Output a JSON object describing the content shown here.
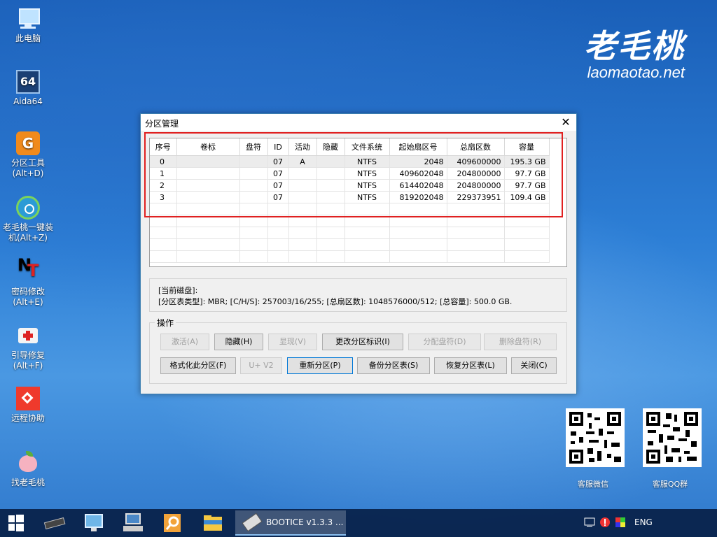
{
  "desktop_icons": [
    {
      "name": "this-pc",
      "label": "此电脑",
      "icon": "computer-icon"
    },
    {
      "name": "aida64",
      "label": "Aida64",
      "icon": "aida64-icon"
    },
    {
      "name": "partition-tool",
      "label": "分区工具\n(Alt+D)",
      "icon": "diskgenius-icon"
    },
    {
      "name": "one-key-install",
      "label": "老毛桃一键装\n机(Alt+Z)",
      "icon": "restore-icon"
    },
    {
      "name": "password-change",
      "label": "密码修改\n(Alt+E)",
      "icon": "ntpwedit-icon"
    },
    {
      "name": "boot-repair",
      "label": "引导修复\n(Alt+F)",
      "icon": "medkit-icon"
    },
    {
      "name": "remote-help",
      "label": "远程协助",
      "icon": "anydesk-icon"
    },
    {
      "name": "find-laomaotao",
      "label": "找老毛桃",
      "icon": "peach-icon"
    }
  ],
  "brand": {
    "cn": "老毛桃",
    "en": "laomaotao.net"
  },
  "qr_codes": [
    {
      "label": "客服微信"
    },
    {
      "label": "客服QQ群"
    }
  ],
  "window": {
    "title": "分区管理",
    "close_glyph": "✕",
    "columns": [
      "序号",
      "卷标",
      "盘符",
      "ID",
      "活动",
      "隐藏",
      "文件系统",
      "起始扇区号",
      "总扇区数",
      "容量"
    ],
    "rows": [
      [
        "0",
        "",
        "",
        "07",
        "A",
        "",
        "NTFS",
        "2048",
        "409600000",
        "195.3 GB"
      ],
      [
        "1",
        "",
        "",
        "07",
        "",
        "",
        "NTFS",
        "409602048",
        "204800000",
        "97.7 GB"
      ],
      [
        "2",
        "",
        "",
        "07",
        "",
        "",
        "NTFS",
        "614402048",
        "204800000",
        "97.7 GB"
      ],
      [
        "3",
        "",
        "",
        "07",
        "",
        "",
        "NTFS",
        "819202048",
        "229373951",
        "109.4 GB"
      ]
    ],
    "info_line1": "[当前磁盘]:",
    "info_line2": "[分区表类型]:  MBR;     [C/H/S]: 257003/16/255; [总扇区数]: 1048576000/512; [总容量]: 500.0 GB.",
    "ops_label": "操作",
    "buttons_row1": [
      {
        "label": "激活(A)",
        "disabled": true
      },
      {
        "label": "隐藏(H)",
        "disabled": false
      },
      {
        "label": "显现(V)",
        "disabled": true
      },
      {
        "label": "更改分区标识(I)",
        "disabled": false
      },
      {
        "label": "分配盘符(D)",
        "disabled": true
      },
      {
        "label": "删除盘符(R)",
        "disabled": true
      }
    ],
    "buttons_row2": [
      {
        "label": "格式化此分区(F)",
        "disabled": false
      },
      {
        "label": "U+ V2",
        "disabled": true
      },
      {
        "label": "重新分区(P)",
        "disabled": false
      },
      {
        "label": "备份分区表(S)",
        "disabled": false
      },
      {
        "label": "恢复分区表(L)",
        "disabled": false
      },
      {
        "label": "关闭(C)",
        "disabled": false
      }
    ]
  },
  "taskbar": {
    "active_app_label": "BOOTICE v1.3.3 ...",
    "language": "ENG"
  },
  "colors": {
    "accent": "#0078d7",
    "highlight_box": "#e02020",
    "taskbar": "#08224a"
  }
}
